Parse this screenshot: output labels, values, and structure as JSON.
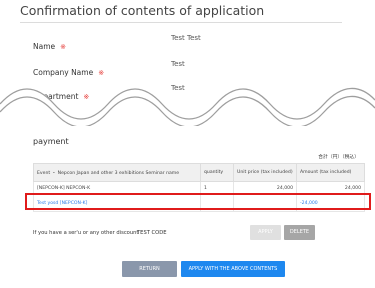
{
  "header": {
    "title": "Confirmation of contents of application"
  },
  "form": {
    "required_mark": "※",
    "fields": [
      {
        "label": "Name",
        "value": "Test Test"
      },
      {
        "label": "Company Name",
        "value": "Test"
      },
      {
        "label": "Department",
        "value": "Test"
      }
    ]
  },
  "payment": {
    "heading": "payment",
    "tax_note": "合計（円）（税込）",
    "columns": [
      "Event ・ Nepcon Japan and other 3 exhibitions Seminar name",
      "quantity",
      "Unit price (tax included)",
      "Amount (tax included)"
    ],
    "rows": [
      {
        "name": "[NEPCON-K] NEPCON-K",
        "quantity": "1",
        "unit_price": "24,000",
        "amount": "24,000"
      }
    ],
    "discount_row": {
      "name": "Test yosd [NEPCON-K]",
      "amount": "-24,000"
    }
  },
  "discount": {
    "label": "If you have a ser'u or any other discount",
    "code": "TEST CODE",
    "apply_label": "APPLY",
    "delete_label": "DELETE"
  },
  "footer": {
    "return_label": "RETURN",
    "apply_all_label": "APPLY WITH THE ABOVE CONTENTS"
  },
  "colors": {
    "accent": "#1e88ef",
    "highlight": "#e01b1b",
    "required": "#e53935"
  }
}
